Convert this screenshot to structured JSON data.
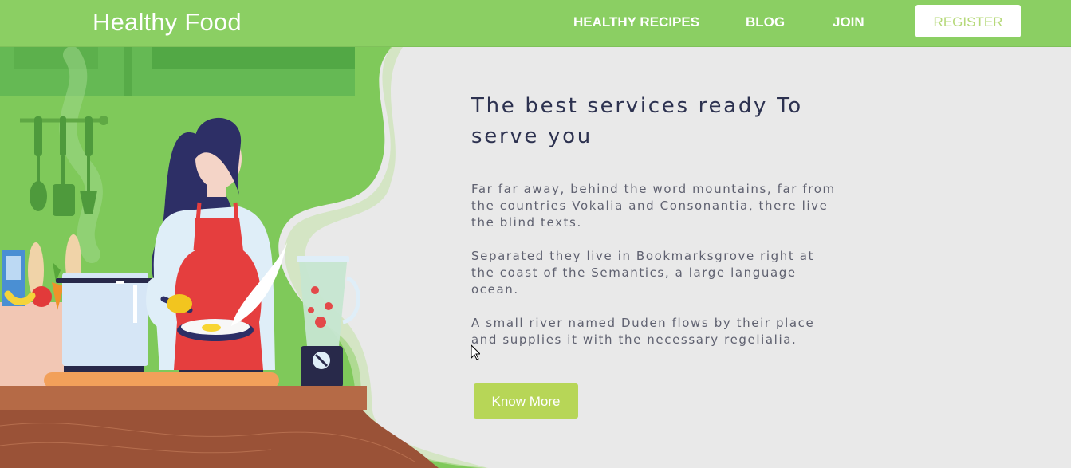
{
  "header": {
    "brand": "Healthy Food",
    "nav": {
      "recipes": "HEALTHY RECIPES",
      "blog": "BLOG",
      "join": "JOIN"
    },
    "register_label": "REGISTER"
  },
  "hero": {
    "heading": "The best services ready To serve you",
    "paragraphs": [
      "Far far away, behind the word mountains, far from the countries Vokalia and Consonantia, there live the blind texts.",
      "Separated they live in Bookmarksgrove right at the coast of the Semantics, a large language ocean.",
      "A small river named Duden flows by their place and supplies it with the necessary regelialia."
    ],
    "button_label": "Know More"
  },
  "colors": {
    "navbar": "#8bcf63",
    "heading": "#2d3250",
    "button": "#b7d657",
    "register_text": "#b6d97a"
  },
  "icons": {
    "cursor": "mouse-pointer-icon",
    "illustration": "woman-cooking-illustration"
  }
}
